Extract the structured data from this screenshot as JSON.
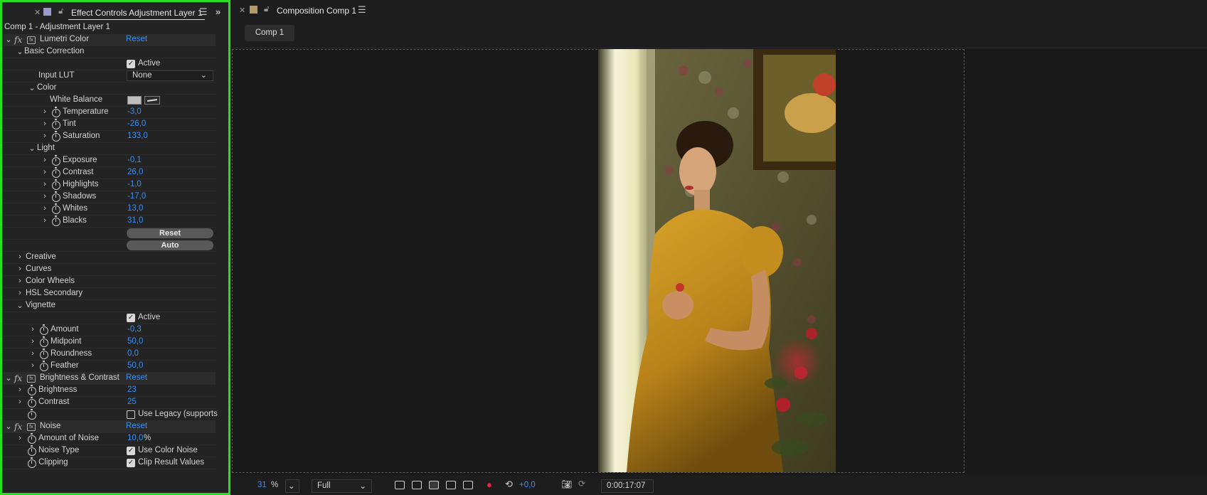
{
  "effect_controls": {
    "tab_title": "Effect Controls Adjustment Layer 1",
    "layer_title": "Comp 1 - Adjustment Layer 1",
    "lumetri": {
      "name": "Lumetri Color",
      "reset": "Reset",
      "basic_correction": "Basic Correction",
      "active_label": "Active",
      "input_lut_label": "Input LUT",
      "input_lut_value": "None",
      "color_group": "Color",
      "white_balance_label": "White Balance",
      "temperature": {
        "label": "Temperature",
        "value": "-3,0"
      },
      "tint": {
        "label": "Tint",
        "value": "-26,0"
      },
      "saturation": {
        "label": "Saturation",
        "value": "133,0"
      },
      "light_group": "Light",
      "exposure": {
        "label": "Exposure",
        "value": "-0,1"
      },
      "contrast": {
        "label": "Contrast",
        "value": "26,0"
      },
      "highlights": {
        "label": "Highlights",
        "value": "-1,0"
      },
      "shadows": {
        "label": "Shadows",
        "value": "-17,0"
      },
      "whites": {
        "label": "Whites",
        "value": "13,0"
      },
      "blacks": {
        "label": "Blacks",
        "value": "31,0"
      },
      "reset_button": "Reset",
      "auto_button": "Auto",
      "creative": "Creative",
      "curves": "Curves",
      "color_wheels": "Color Wheels",
      "hsl_secondary": "HSL Secondary",
      "vignette": "Vignette",
      "vignette_active": "Active",
      "amount": {
        "label": "Amount",
        "value": "-0,3"
      },
      "midpoint": {
        "label": "Midpoint",
        "value": "50,0"
      },
      "roundness": {
        "label": "Roundness",
        "value": "0,0"
      },
      "feather": {
        "label": "Feather",
        "value": "50,0"
      }
    },
    "brightness_contrast": {
      "name": "Brightness & Contrast",
      "reset": "Reset",
      "brightness": {
        "label": "Brightness",
        "value": "23"
      },
      "contrast": {
        "label": "Contrast",
        "value": "25"
      },
      "use_legacy": "Use Legacy (supports"
    },
    "noise": {
      "name": "Noise",
      "reset": "Reset",
      "amount_label": "Amount of Noise",
      "amount_value": "10,0",
      "amount_unit": "%",
      "noise_type_label": "Noise Type",
      "use_color_noise": "Use Color Noise",
      "clipping_label": "Clipping",
      "clip_result": "Clip Result Values"
    }
  },
  "composition": {
    "tab_title": "Composition Comp 1",
    "subtab": "Comp 1",
    "zoom_value": "31",
    "zoom_unit": "%",
    "resolution": "Full",
    "exposure_value": "+0,0",
    "timecode": "0:00:17:07"
  },
  "colors": {
    "accent_blue": "#3d8ff0",
    "highlight_border": "#25e01f",
    "ec_tab_swatch": "#9a9ad0",
    "comp_tab_swatch": "#b49a6a"
  }
}
